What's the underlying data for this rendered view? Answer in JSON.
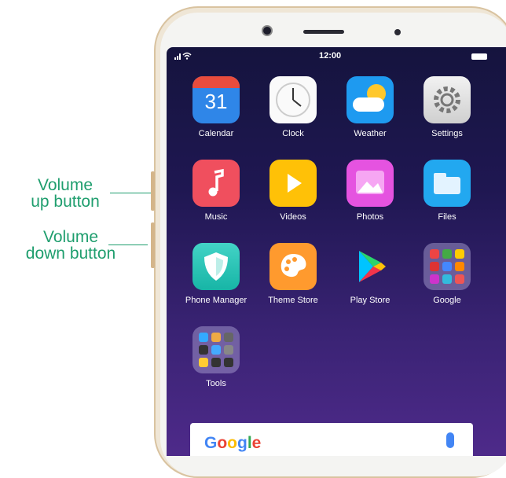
{
  "callouts": {
    "volume_up": "Volume\nup button",
    "volume_down": "Volume\ndown button"
  },
  "status_bar": {
    "time": "12:00"
  },
  "apps": [
    {
      "label": "Calendar",
      "icon": "calendar-icon",
      "text": "31"
    },
    {
      "label": "Clock",
      "icon": "clock-icon"
    },
    {
      "label": "Weather",
      "icon": "weather-icon"
    },
    {
      "label": "Settings",
      "icon": "gear-icon"
    },
    {
      "label": "Music",
      "icon": "music-note-icon"
    },
    {
      "label": "Videos",
      "icon": "play-icon"
    },
    {
      "label": "Photos",
      "icon": "photo-icon"
    },
    {
      "label": "Files",
      "icon": "folder-icon"
    },
    {
      "label": "Phone Manager",
      "icon": "shield-icon"
    },
    {
      "label": "Theme Store",
      "icon": "palette-icon"
    },
    {
      "label": "Play Store",
      "icon": "play-store-icon"
    },
    {
      "label": "Google",
      "icon": "folder-grid-icon"
    },
    {
      "label": "Tools",
      "icon": "folder-grid-icon"
    }
  ],
  "search": {
    "brand": "Google"
  },
  "colors": {
    "callout": "#1f9e6e",
    "screen_top": "#15143e",
    "screen_bottom": "#4e2a8a"
  }
}
